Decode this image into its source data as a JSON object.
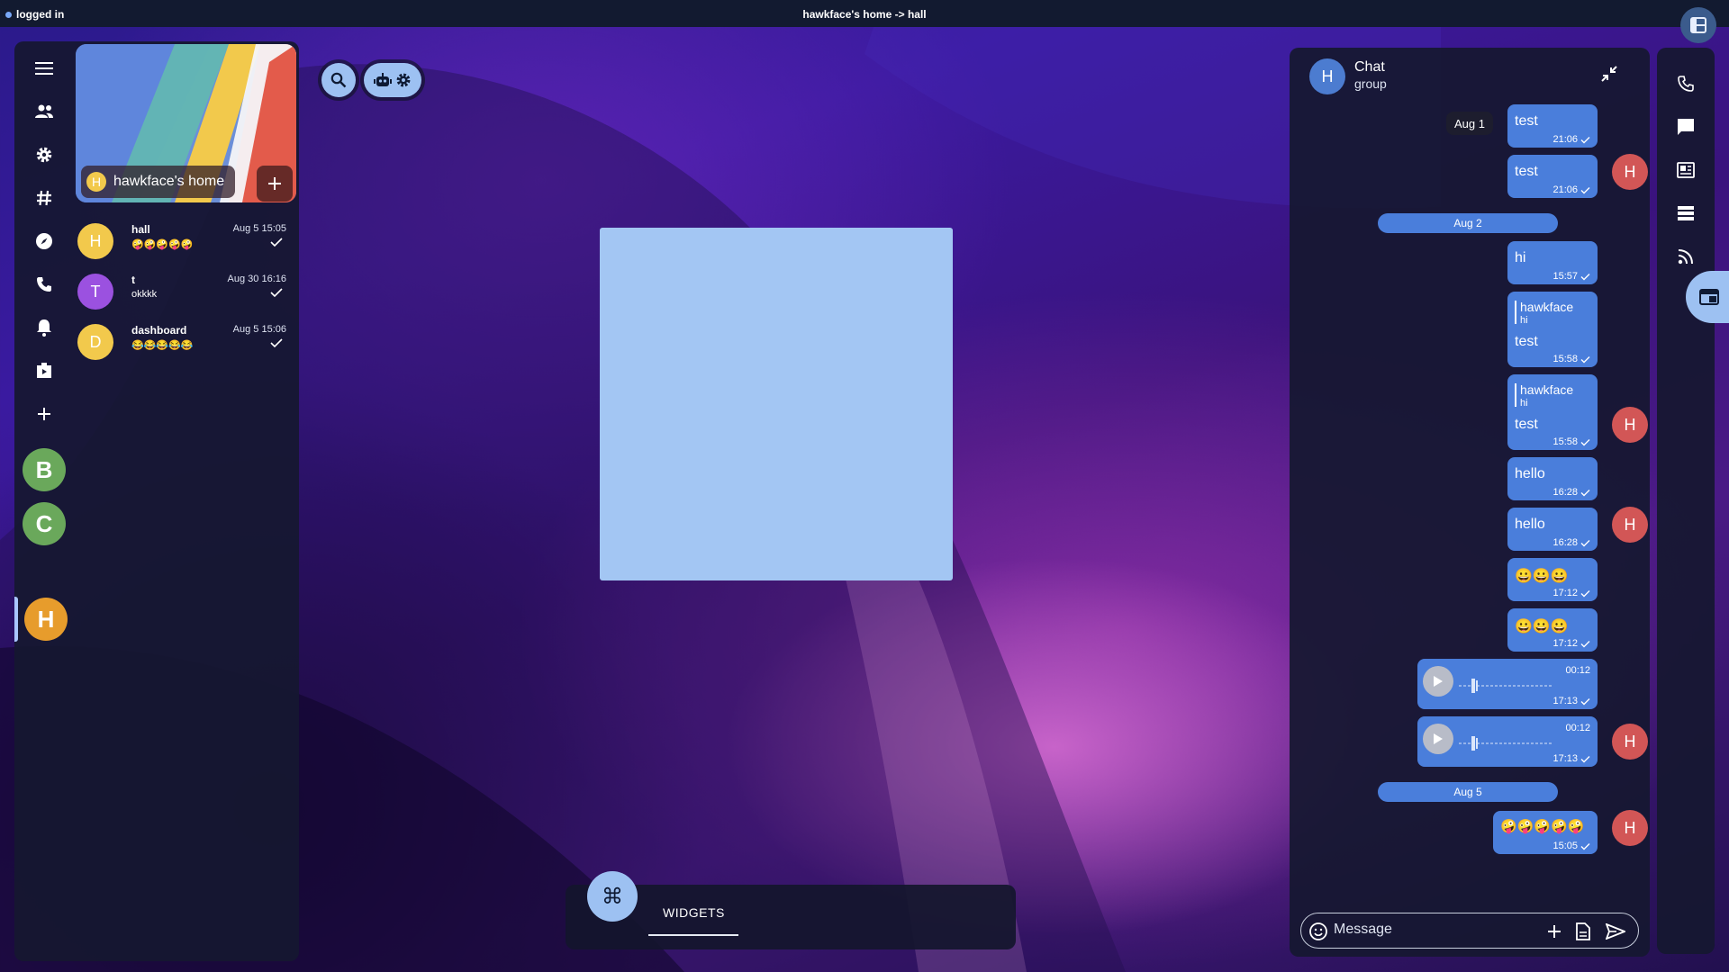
{
  "topbar": {
    "status_text": "logged in",
    "title": "hawkface's home -> hall",
    "layout_icon": "layout-icon"
  },
  "left_rail": {
    "icons": [
      "menu-icon",
      "people-icon",
      "gear-icon",
      "hashtag-icon",
      "compass-icon",
      "phone-icon",
      "bell-icon",
      "media-icon",
      "plus-icon"
    ],
    "spaces": [
      {
        "letter": "B",
        "color": "#6aa85b"
      },
      {
        "letter": "C",
        "color": "#6aa85b"
      },
      {
        "letter": "H",
        "color": "#e79c2c"
      }
    ]
  },
  "space_header": {
    "avatar_letter": "H",
    "name": "hawkface's home",
    "add_label": "+"
  },
  "rooms": [
    {
      "letter": "H",
      "color": "#f2c94c",
      "name": "hall",
      "time": "Aug 5 15:05",
      "preview": "🤪🤪🤪🤪🤪"
    },
    {
      "letter": "T",
      "color": "#9b51e0",
      "name": "t",
      "time": "Aug 30 16:16",
      "preview": "okkkk"
    },
    {
      "letter": "D",
      "color": "#f2c94c",
      "name": "dashboard",
      "time": "Aug 5 15:06",
      "preview": "😂😂😂😂😂"
    }
  ],
  "widgets_bar": {
    "command_symbol": "⌘",
    "tab_label": "WIDGETS"
  },
  "chat": {
    "avatar_letter": "H",
    "title": "Chat",
    "subtitle": "group",
    "sender_letter": "H",
    "dates": {
      "aug1": "Aug 1",
      "aug2": "Aug 2",
      "aug5": "Aug 5"
    },
    "messages": [
      {
        "text": "test",
        "time": "21:06"
      },
      {
        "text": "test",
        "time": "21:06"
      },
      {
        "text": "hi",
        "time": "15:57"
      },
      {
        "reply_name": "hawkface",
        "reply_text": "hi",
        "text": "test",
        "time": "15:58"
      },
      {
        "reply_name": "hawkface",
        "reply_text": "hi",
        "text": "test",
        "time": "15:58"
      },
      {
        "text": "hello",
        "time": "16:28"
      },
      {
        "text": "hello",
        "time": "16:28"
      },
      {
        "text": "😀😀😀",
        "time": "17:12"
      },
      {
        "text": "😀😀😀",
        "time": "17:12"
      },
      {
        "voice_duration": "00:12",
        "time": "17:13"
      },
      {
        "voice_duration": "00:12",
        "time": "17:13"
      },
      {
        "text": "🤪🤪🤪🤪🤪",
        "time": "15:05"
      }
    ],
    "composer": {
      "placeholder": "Message"
    }
  },
  "right_rail": {
    "icons": [
      "phone-icon",
      "chat-icon",
      "newspaper-icon",
      "server-icon",
      "rss-icon",
      "window-icon"
    ]
  }
}
